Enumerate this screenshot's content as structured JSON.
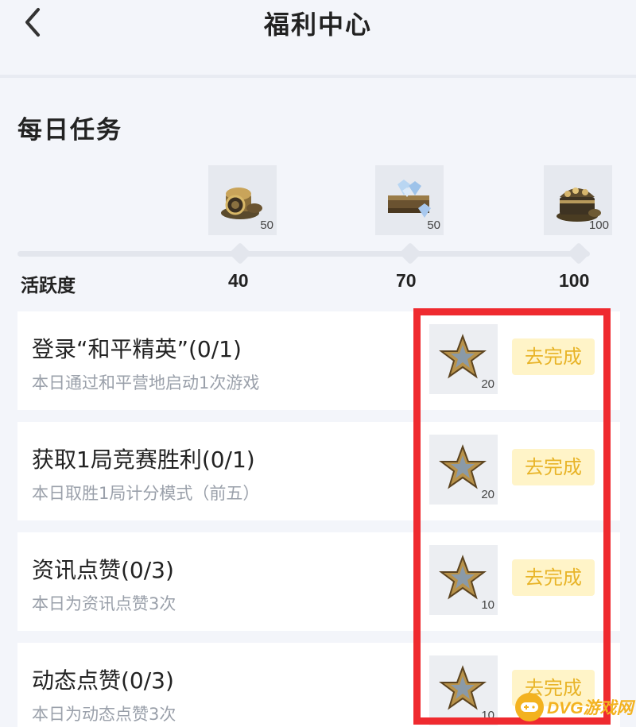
{
  "header": {
    "title": "福利中心",
    "back_icon": "chevron-left-icon"
  },
  "section": {
    "title": "每日任务"
  },
  "activity": {
    "label": "活跃度",
    "milestones": [
      {
        "mark": "40",
        "reward_count": "50",
        "icon": "coin-pile-icon"
      },
      {
        "mark": "70",
        "reward_count": "50",
        "icon": "diamond-crate-icon"
      },
      {
        "mark": "100",
        "reward_count": "100",
        "icon": "treasure-chest-icon"
      }
    ]
  },
  "tasks": [
    {
      "name": "登录“和平精英”(0/1)",
      "desc": "本日通过和平营地启动1次游戏",
      "reward_count": "20",
      "button": "去完成"
    },
    {
      "name": "获取1局竞赛胜利(0/1)",
      "desc": "本日取胜1局计分模式（前五）",
      "reward_count": "20",
      "button": "去完成"
    },
    {
      "name": "资讯点赞(0/3)",
      "desc": "本日为资讯点赞3次",
      "reward_count": "10",
      "button": "去完成"
    },
    {
      "name": "动态点赞(0/3)",
      "desc": "本日为动态点赞3次",
      "reward_count": "10",
      "button": "去完成"
    }
  ],
  "colors": {
    "accent_button_bg": "#fff4c8",
    "accent_button_text": "#e8b428",
    "highlight": "#ef2a2f"
  },
  "watermark": {
    "text": "DVG游戏网"
  }
}
